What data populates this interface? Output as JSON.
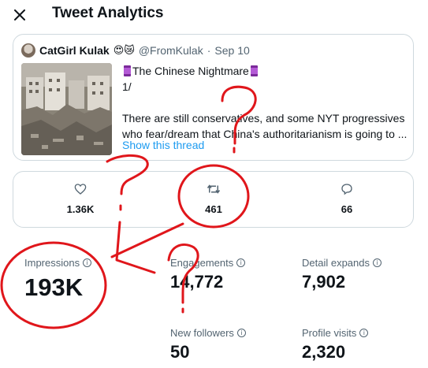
{
  "header": {
    "title": "Tweet Analytics",
    "close_icon": "close-icon"
  },
  "tweet": {
    "author_name": "CatGirl Kulak",
    "author_emojis": "😍😿",
    "handle": "@FromKulak",
    "separator": "·",
    "date": "Sep 10",
    "title_line": "The Chinese Nightmare",
    "line2": "1/",
    "body_line1": "There are still conservatives, and some NYT progressives",
    "body_line2": "who fear/dream that China's authoritarianism is going to ...",
    "show_thread": "Show this thread"
  },
  "engagement_bar": {
    "likes": "1.36K",
    "retweets": "461",
    "replies": "66"
  },
  "stats": {
    "impressions_label": "Impressions",
    "impressions_value": "193K",
    "engagements_label": "Engagements",
    "engagements_value": "14,772",
    "detail_expands_label": "Detail expands",
    "detail_expands_value": "7,902",
    "new_followers_label": "New followers",
    "new_followers_value": "50",
    "profile_visits_label": "Profile visits",
    "profile_visits_value": "2,320",
    "info_icon": "ⓘ"
  },
  "annotation_colors": {
    "ink": "#e0161b",
    "link_blue": "#1d9bf0"
  }
}
